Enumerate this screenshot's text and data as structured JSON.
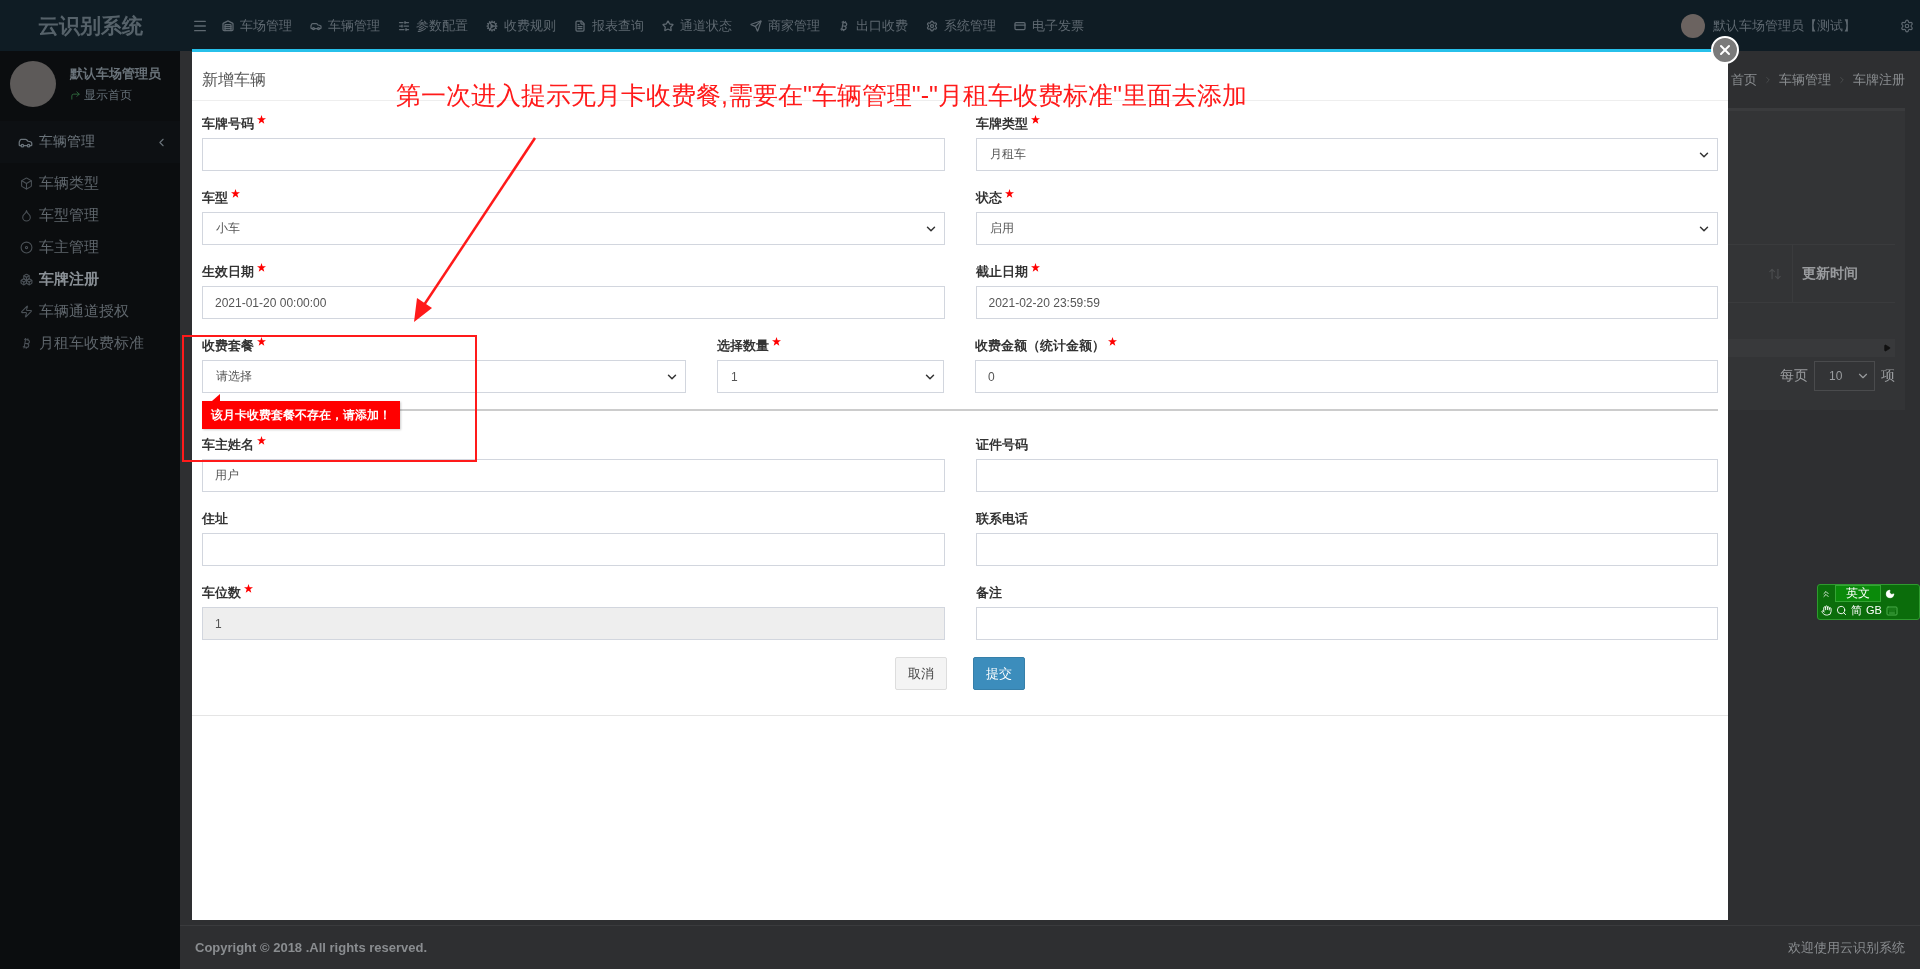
{
  "nav": {
    "brand": "云识别系统",
    "items": [
      {
        "label": "车场管理"
      },
      {
        "label": "车辆管理"
      },
      {
        "label": "参数配置"
      },
      {
        "label": "收费规则"
      },
      {
        "label": "报表查询"
      },
      {
        "label": "通道状态"
      },
      {
        "label": "商家管理"
      },
      {
        "label": "出口收费"
      },
      {
        "label": "系统管理"
      },
      {
        "label": "电子发票"
      }
    ],
    "user": "默认车场管理员【测试】"
  },
  "sidebar": {
    "user": {
      "name": "默认车场管理员",
      "link": "显示首页"
    },
    "menu": [
      {
        "label": "车辆管理",
        "expanded": true,
        "children": [
          {
            "label": "车辆类型",
            "selected": false
          },
          {
            "label": "车型管理",
            "selected": false
          },
          {
            "label": "车主管理",
            "selected": false
          },
          {
            "label": "车牌注册",
            "selected": true
          },
          {
            "label": "车辆通道授权",
            "selected": false
          },
          {
            "label": "月租车收费标准",
            "selected": false
          }
        ]
      }
    ]
  },
  "background": {
    "breadcrumb": [
      "首页",
      "车辆管理",
      "车牌注册"
    ],
    "table": {
      "columns": [
        "更新时间"
      ]
    },
    "page_size": {
      "prefix": "每页",
      "value": "10",
      "suffix": "项"
    }
  },
  "footer": {
    "copyright": "Copyright © 2018 .All rights reserved.",
    "welcome": "欢迎使用云识别系统"
  },
  "modal": {
    "title": "新增车辆",
    "sections": [
      {
        "rows": [
          {
            "fields": [
              {
                "label": "车牌号码",
                "required": true,
                "kind": "text",
                "disabled": false
              },
              {
                "label": "车牌类型",
                "required": true,
                "kind": "select",
                "value": "月租车",
                "disabled": false
              }
            ]
          },
          {
            "fields": [
              {
                "label": "车型",
                "required": true,
                "kind": "select",
                "value": "小车",
                "disabled": false
              },
              {
                "label": "状态",
                "required": true,
                "kind": "select",
                "value": "启用",
                "disabled": false
              }
            ]
          },
          {
            "fields": [
              {
                "label": "生效日期",
                "required": true,
                "kind": "text",
                "value": "2021-01-20 00:00:00",
                "disabled": false
              },
              {
                "label": "截止日期",
                "required": true,
                "kind": "text",
                "value": "2021-02-20 23:59:59",
                "disabled": false
              }
            ]
          },
          {
            "fields": [
              {
                "label": "收费套餐",
                "required": true,
                "kind": "select",
                "value": "请选择",
                "disabled": false,
                "error": "该月卡收费套餐不存在，请添加！"
              },
              {
                "label": "选择数量",
                "required": true,
                "kind": "select",
                "value": "1",
                "disabled": false
              },
              {
                "label": "收费金额（统计金额）",
                "required": true,
                "kind": "text",
                "value": "0",
                "disabled": false
              }
            ]
          }
        ]
      },
      {
        "rows": [
          {
            "fields": [
              {
                "label": "车主姓名",
                "required": true,
                "kind": "text",
                "value": "用户",
                "disabled": false
              },
              {
                "label": "证件号码",
                "required": false,
                "kind": "text",
                "disabled": false
              }
            ]
          },
          {
            "fields": [
              {
                "label": "住址",
                "required": false,
                "kind": "text",
                "disabled": false
              },
              {
                "label": "联系电话",
                "required": false,
                "kind": "text",
                "disabled": false
              }
            ]
          },
          {
            "fields": [
              {
                "label": "车位数",
                "required": true,
                "kind": "text",
                "value": "1",
                "disabled": true
              },
              {
                "label": "备注",
                "required": false,
                "kind": "text",
                "disabled": false
              }
            ]
          }
        ]
      }
    ],
    "buttons": [
      {
        "label": "取消",
        "kind": "default"
      },
      {
        "label": "提交",
        "kind": "primary"
      }
    ]
  },
  "annotation": {
    "text": "第一次进入提示无月卡收费餐,需要在\"车辆管理\"-\"月租车收费标准\"里面去添加"
  },
  "ime_toolbar": {
    "mode": "英文",
    "charset": "简",
    "encoding": "GB"
  }
}
